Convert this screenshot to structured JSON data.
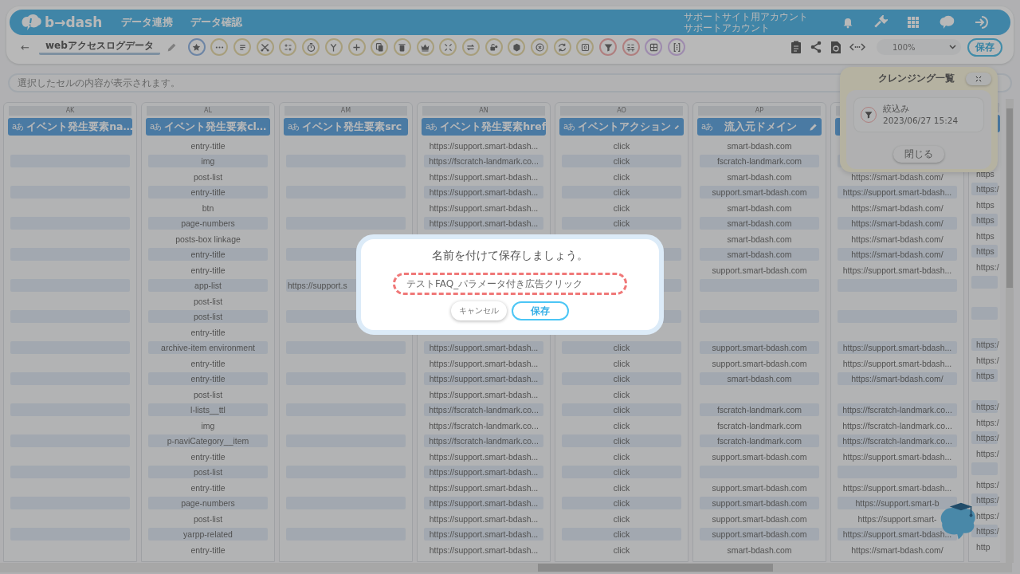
{
  "header": {
    "logo": "b→dash",
    "nav": [
      {
        "label": "データ連携"
      },
      {
        "label": "データ確認"
      }
    ],
    "account": {
      "site": "サポートサイト用アカウント",
      "name": "サポートアカウント"
    }
  },
  "toolbar": {
    "back": "←",
    "dataset_name": "webアクセスログデータ",
    "zoom": "100%",
    "save": "保存"
  },
  "cell_viewer": {
    "placeholder": "選択したセルの内容が表示されます。"
  },
  "columns": [
    {
      "kind": "full",
      "letter": "AK",
      "type_label": "aあ",
      "title": "イベント発生要素na…",
      "cells": [
        null,
        null,
        null,
        null,
        null,
        null,
        null,
        null,
        null,
        null,
        null,
        null,
        null,
        null,
        null,
        null,
        null,
        null,
        null,
        null,
        null,
        null,
        null,
        null,
        null,
        null,
        null
      ]
    },
    {
      "kind": "full",
      "letter": "AL",
      "type_label": "aあ",
      "title": "イベント発生要素cl…",
      "cells": [
        "entry-title",
        "img",
        "post-list",
        "entry-title",
        "btn",
        "page-numbers",
        "posts-box linkage",
        "entry-title",
        "entry-title",
        "app-list",
        "post-list",
        "post-list",
        "entry-title",
        "archive-item environment",
        "entry-title",
        "entry-title",
        "post-list",
        "l-lists__ttl",
        "img",
        "p-naviCategory__item",
        "entry-title",
        "post-list",
        "entry-title",
        "page-numbers",
        "post-list",
        "yarpp-related",
        "entry-title"
      ]
    },
    {
      "kind": "full",
      "letter": "AM",
      "type_label": "aあ",
      "title": "イベント発生要素src",
      "cells": [
        null,
        null,
        null,
        null,
        null,
        null,
        null,
        null,
        null,
        {
          "value": "https://support.s",
          "cut": true
        },
        null,
        null,
        null,
        null,
        null,
        null,
        null,
        null,
        null,
        null,
        null,
        null,
        null,
        null,
        null,
        null,
        null
      ]
    },
    {
      "kind": "full",
      "letter": "AN",
      "type_label": "aあ",
      "title": "イベント発生要素href",
      "cells": [
        "https://support.smart-bdash...",
        "https://fscratch-landmark.co...",
        "https://support.smart-bdash...",
        "https://support.smart-bdash...",
        "https://support.smart-bdash...",
        "https://support.smart-bdash...",
        null,
        null,
        null,
        null,
        null,
        null,
        null,
        "https://support.smart-bdash...",
        "https://support.smart-bdash...",
        "https://support.smart-bdash...",
        "https://support.smart-bdash...",
        "https://fscratch-landmark.co...",
        "https://fscratch-landmark.co...",
        "https://fscratch-landmark.co...",
        "https://support.smart-bdash...",
        "https://support.smart-bdash...",
        "https://support.smart-bdash...",
        "https://support.smart-bdash...",
        "https://support.smart-bdash...",
        "https://support.smart-bdash...",
        "https://support.smart-bdash..."
      ]
    },
    {
      "kind": "full",
      "letter": "AO",
      "type_label": "aあ",
      "title": "イベントアクション",
      "cells": [
        "click",
        "click",
        "click",
        "click",
        "click",
        "click",
        null,
        null,
        null,
        null,
        null,
        null,
        null,
        "click",
        "click",
        "click",
        "click",
        "click",
        "click",
        "click",
        "click",
        "click",
        "click",
        "click",
        "click",
        "click",
        "click"
      ]
    },
    {
      "kind": "full",
      "letter": "AP",
      "type_label": "aあ",
      "title": "流入元ドメイン",
      "cells": [
        "smart-bdash.com",
        "fscratch-landmark.com",
        "smart-bdash.com",
        "support.smart-bdash.com",
        "smart-bdash.com",
        "smart-bdash.com",
        "smart-bdash.com",
        "smart-bdash.com",
        "support.smart-bdash.com",
        null,
        null,
        null,
        null,
        "support.smart-bdash.com",
        "support.smart-bdash.com",
        "smart-bdash.com",
        null,
        "fscratch-landmark.com",
        "fscratch-landmark.com",
        "fscratch-landmark.com",
        "support.smart-bdash.com",
        null,
        "support.smart-bdash.com",
        "support.smart-bdash.com",
        "support.smart-bdash.com",
        "support.smart-bdash.com",
        "smart-bdash.com"
      ]
    },
    {
      "kind": "full",
      "cells": [
        null,
        null,
        "https://smart-bdash.com/",
        "https://support.smart-bdash...",
        "https://smart-bdash.com/",
        "https://smart-bdash.com/",
        "https://smart-bdash.com/",
        "https://smart-bdash.com/",
        "https://support.smart-bdash...",
        null,
        null,
        null,
        null,
        "https://support.smart-bdash...",
        "https://support.smart-bdash...",
        "https://smart-bdash.com/",
        null,
        "https://fscratch-landmark.co...",
        "https://fscratch-landmark.co...",
        "https://fscratch-landmark.co...",
        "https://support.smart-bdash...",
        null,
        "https://support.smart-bdash...",
        "https://support.smart-b",
        "https://support.smart-",
        "https://support.smart-bdash...",
        "https://smart-bdash.com/"
      ]
    },
    {
      "kind": "cut",
      "cells": [
        null,
        null,
        "https",
        "https:/",
        "https",
        "https",
        "https",
        "https",
        "https:/",
        null,
        null,
        null,
        null,
        "https:/",
        "https:/",
        "https",
        null,
        "https:/",
        "https:/",
        "https:/",
        "https:/",
        null,
        "https:/",
        "https:/",
        "https:/",
        "https:/",
        "http"
      ]
    }
  ],
  "cleansing_panel": {
    "title": "クレンジング一覧",
    "steps": [
      {
        "label": "絞込み",
        "time": "2023/06/27 15:24"
      }
    ],
    "close": "閉じる"
  },
  "dialog": {
    "title": "名前を付けて保存しましょう。",
    "name_value": "テストFAQ_パラメータ付き広告クリック",
    "buttons": [
      {
        "kind": "secondary",
        "label": "キャンセル"
      },
      {
        "kind": "primary",
        "label": "保存"
      }
    ]
  }
}
